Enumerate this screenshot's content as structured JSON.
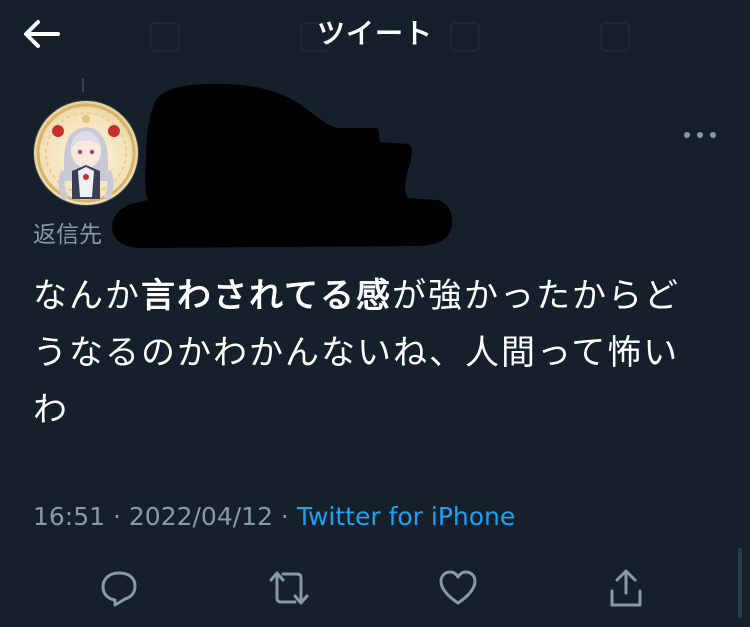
{
  "header": {
    "title": "ツイート",
    "back_icon": "arrow-left-icon"
  },
  "author": {
    "avatar_icon": "avatar",
    "name_redacted": true,
    "more_icon": "more-horizontal-icon"
  },
  "reply": {
    "label": "返信先"
  },
  "tweet": {
    "text_1": "なんか",
    "text_bold": "言わされてる感",
    "text_2": "が強かったからどうなるのかわかんないね、人間って怖いわ"
  },
  "meta": {
    "time": "16:51",
    "sep1": " · ",
    "date": "2022/04/12",
    "sep2": " · ",
    "source": "Twitter for iPhone"
  },
  "actions": [
    {
      "icon": "reply-icon"
    },
    {
      "icon": "retweet-icon"
    },
    {
      "icon": "like-icon"
    },
    {
      "icon": "share-icon"
    }
  ],
  "colors": {
    "background": "#15202b",
    "text": "#ffffff",
    "secondary": "#8899a6",
    "accent": "#1da1f2"
  }
}
